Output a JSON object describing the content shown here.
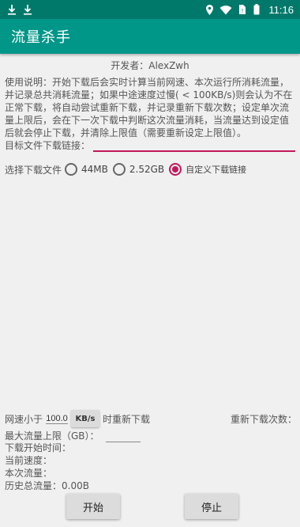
{
  "status_bar": {
    "time": "11:16",
    "left_icons": [
      "download-icon",
      "download-icon"
    ],
    "right_icons": [
      "location-icon",
      "wifi-icon",
      "sim-icon",
      "battery-icon"
    ]
  },
  "app_bar": {
    "title": "流量杀手"
  },
  "developer": "开发者：AlexZwh",
  "usage_text": "使用说明：开始下载后会实时计算当前网速、本次运行所消耗流量，并记录总共消耗流量；如果中途速度过慢( < 100KB/s)则会认为不在正常下载，将自动尝试重新下载，并记录重新下载次数；设定单次流量上限后，会在下一次下载中判断这次流量消耗，当流量达到设定值后就会停止下载，并清除上限值（需要重新设定上限值）。",
  "target": {
    "label": "目标文件下载链接：",
    "value": ""
  },
  "choose": {
    "label": "选择下载文件",
    "options": [
      "44MB",
      "2.52GB",
      "自定义下载链接"
    ],
    "selected": "自定义下载链接"
  },
  "speed": {
    "prefix": "网速小于",
    "value": "100.0",
    "unit_button": "KB/s",
    "suffix": "时重新下载",
    "retry_label": "重新下载次数："
  },
  "limit": {
    "label": "最大流量上限（GB）：",
    "value": ""
  },
  "info": {
    "start_time": "下载开始时间：",
    "current_speed": "当前速度：",
    "this_traffic": "本次流量：",
    "total_traffic": "历史总流量：0.00B"
  },
  "buttons": {
    "start": "开始",
    "stop": "停止"
  },
  "colors": {
    "status_bar": "#00796b",
    "app_bar": "#009688",
    "accent": "#c2185b"
  }
}
